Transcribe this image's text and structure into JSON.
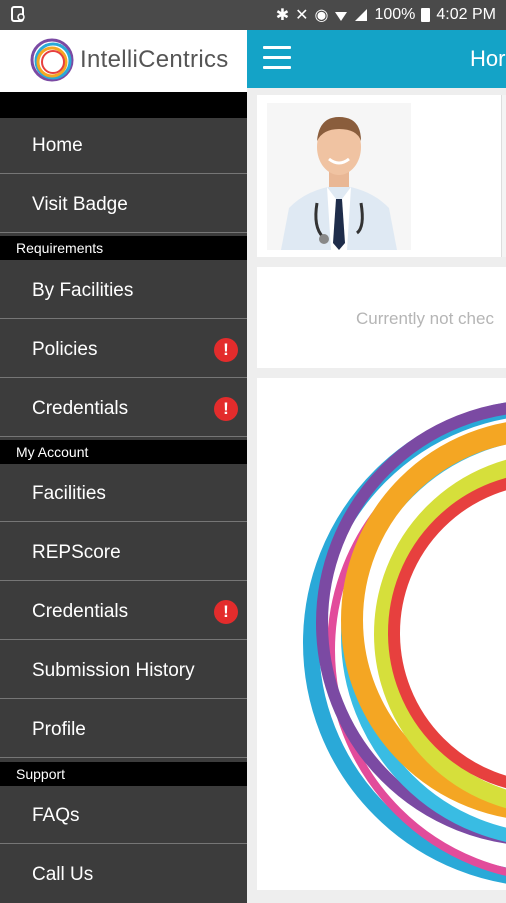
{
  "status_bar": {
    "battery_text": "100%",
    "time": "4:02 PM"
  },
  "app_bar": {
    "title": "Hor"
  },
  "main": {
    "checkin_message": "Currently not chec"
  },
  "drawer": {
    "brand": "IntelliCentrics",
    "items": [
      {
        "label": "Home"
      },
      {
        "label": "Visit Badge"
      }
    ],
    "sections": [
      {
        "title": "Requirements",
        "items": [
          {
            "label": "By Facilities",
            "alert": false
          },
          {
            "label": "Policies",
            "alert": true,
            "alert_symbol": "!"
          },
          {
            "label": "Credentials",
            "alert": true,
            "alert_symbol": "!"
          }
        ]
      },
      {
        "title": "My Account",
        "items": [
          {
            "label": "Facilities",
            "alert": false
          },
          {
            "label": "REPScore",
            "alert": false
          },
          {
            "label": "Credentials",
            "alert": true,
            "alert_symbol": "!"
          },
          {
            "label": "Submission History",
            "alert": false
          },
          {
            "label": "Profile",
            "alert": false
          }
        ]
      },
      {
        "title": "Support",
        "items": [
          {
            "label": "FAQs",
            "alert": false
          },
          {
            "label": "Call Us",
            "alert": false
          }
        ]
      }
    ]
  },
  "icons": {
    "alert": "exclamation-alert-icon",
    "menu": "hamburger-menu-icon"
  },
  "colors": {
    "app_bar": "#14a3c7",
    "drawer_bg": "#3c3c3c",
    "alert": "#e32c2c"
  }
}
